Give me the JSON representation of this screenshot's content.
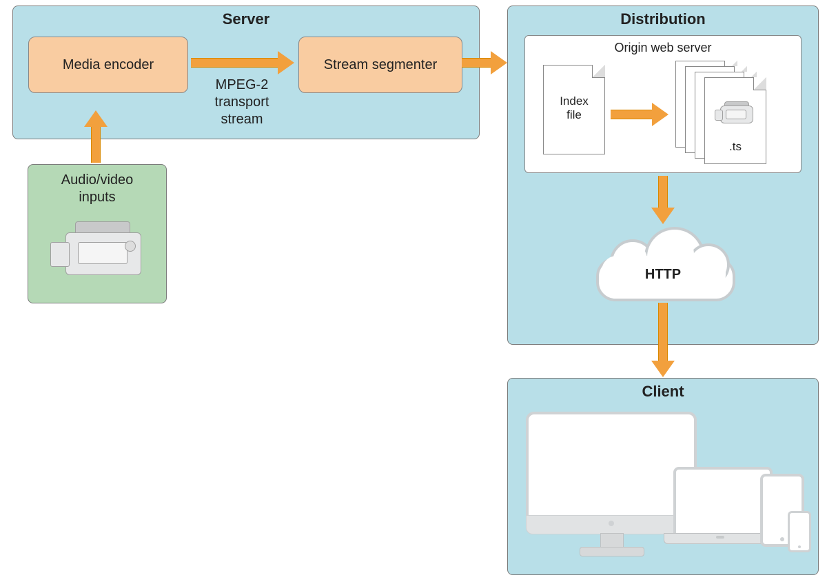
{
  "server": {
    "title": "Server",
    "media_encoder": "Media encoder",
    "stream_segmenter": "Stream segmenter",
    "transport_label": "MPEG-2\ntransport\nstream"
  },
  "inputs": {
    "title": "Audio/video\ninputs"
  },
  "distribution": {
    "title": "Distribution",
    "origin_title": "Origin web server",
    "index_file": "Index\nfile",
    "ts_ext": ".ts",
    "http_label": "HTTP"
  },
  "client": {
    "title": "Client"
  },
  "colors": {
    "panel_blue": "#b8dfe8",
    "panel_green": "#b5d9b6",
    "block_orange": "#f9cca1",
    "arrow_orange": "#f2a03d"
  },
  "icons": {
    "camcorder": "camcorder-icon",
    "cloud": "cloud-icon",
    "file": "file-icon",
    "ts_files": "file-stack-icon",
    "monitor": "desktop-monitor-icon",
    "laptop": "laptop-icon",
    "tablet": "tablet-icon",
    "phone": "phone-icon"
  }
}
